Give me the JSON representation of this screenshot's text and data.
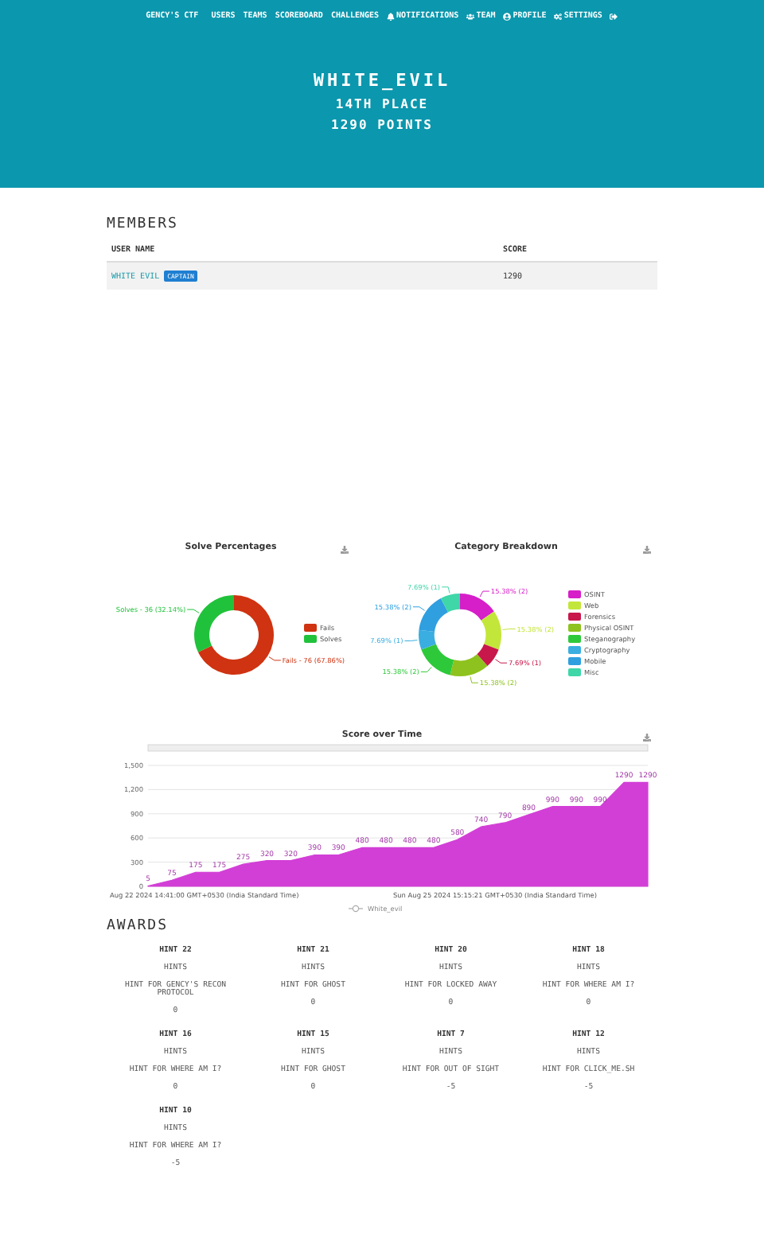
{
  "nav": {
    "brand": "GENCY'S CTF",
    "links": [
      {
        "label": "USERS"
      },
      {
        "label": "TEAMS"
      },
      {
        "label": "SCOREBOARD"
      },
      {
        "label": "CHALLENGES"
      },
      {
        "label": "NOTIFICATIONS"
      },
      {
        "label": "TEAM"
      },
      {
        "label": "PROFILE"
      },
      {
        "label": "SETTINGS"
      }
    ]
  },
  "hero": {
    "name": "WHITE_EVIL",
    "place": "14TH PLACE",
    "points": "1290 POINTS"
  },
  "members": {
    "title": "MEMBERS",
    "columns": [
      "USER NAME",
      "SCORE"
    ],
    "rows": [
      {
        "name": "WHITE EVIL",
        "badge": "CAPTAIN",
        "score": "1290"
      }
    ]
  },
  "solve_chart": {
    "chart_data": {
      "type": "donut",
      "title": "Solve Percentages",
      "categories": [
        "Fails",
        "Solves"
      ],
      "values": [
        67.86,
        32.14
      ],
      "colors": [
        "#cf3311",
        "#21c23b"
      ],
      "value_labels": [
        "Fails - 76 (67.86%)",
        "Solves - 36 (32.14%)"
      ],
      "legend": true
    }
  },
  "category_chart": {
    "chart_data": {
      "type": "donut",
      "title": "Category Breakdown",
      "categories": [
        "OSINT",
        "Web",
        "Forensics",
        "Physical OSINT",
        "Steganography",
        "Cryptography",
        "Mobile",
        "Misc"
      ],
      "values": [
        15.38,
        15.38,
        7.69,
        15.38,
        15.38,
        7.69,
        15.38,
        7.69
      ],
      "colors": [
        "#d61fc8",
        "#c3e63a",
        "#c8174b",
        "#8ec21e",
        "#2ec93b",
        "#3aaee0",
        "#2f9fe0",
        "#3fd6a8"
      ],
      "value_labels": [
        "15.38% (2)",
        "15.38% (2)",
        "7.69% (1)",
        "15.38% (2)",
        "15.38% (2)",
        "7.69% (1)",
        "15.38% (2)",
        "7.69% (1)"
      ],
      "legend": true
    }
  },
  "score_chart": {
    "chart_data": {
      "type": "area",
      "title": "Score over Time",
      "series": [
        {
          "name": "White_evil",
          "color": "#d23fd6",
          "values": [
            5,
            75,
            175,
            175,
            275,
            320,
            320,
            390,
            390,
            480,
            480,
            480,
            480,
            580,
            740,
            790,
            890,
            990,
            990,
            990,
            1290,
            1290
          ]
        }
      ],
      "ylim": [
        0,
        1500
      ],
      "yticks": [
        {
          "value": 0,
          "label": "0"
        },
        {
          "value": 300,
          "label": "300"
        },
        {
          "value": 600,
          "label": "600"
        },
        {
          "value": 900,
          "label": "900"
        },
        {
          "value": 1200,
          "label": "1,200"
        },
        {
          "value": 1500,
          "label": "1,500"
        }
      ],
      "grid": true,
      "legend": true,
      "data_labels": true
    },
    "date_labels": [
      "Aug 22 2024 14:41:00 GMT+0530 (India Standard Time)",
      "Sun Aug 25 2024 15:15:21 GMT+0530 (India Standard Time)"
    ]
  },
  "awards": {
    "title": "AWARDS",
    "items": [
      {
        "name": "HINT 22",
        "category": "HINTS",
        "description": "HINT FOR GENCY'S RECON PROTOCOL",
        "value": "0"
      },
      {
        "name": "HINT 21",
        "category": "HINTS",
        "description": "HINT FOR GHOST",
        "value": "0"
      },
      {
        "name": "HINT 20",
        "category": "HINTS",
        "description": "HINT FOR LOCKED AWAY",
        "value": "0"
      },
      {
        "name": "HINT 18",
        "category": "HINTS",
        "description": "HINT FOR WHERE AM I?",
        "value": "0"
      },
      {
        "name": "HINT 16",
        "category": "HINTS",
        "description": "HINT FOR WHERE AM I?",
        "value": "0"
      },
      {
        "name": "HINT 15",
        "category": "HINTS",
        "description": "HINT FOR GHOST",
        "value": "0"
      },
      {
        "name": "HINT 7",
        "category": "HINTS",
        "description": "HINT FOR OUT OF SIGHT",
        "value": "-5"
      },
      {
        "name": "HINT 12",
        "category": "HINTS",
        "description": "HINT FOR CLICK_ME.SH",
        "value": "-5"
      },
      {
        "name": "HINT 10",
        "category": "HINTS",
        "description": "HINT FOR WHERE AM I?",
        "value": "-5"
      }
    ]
  }
}
